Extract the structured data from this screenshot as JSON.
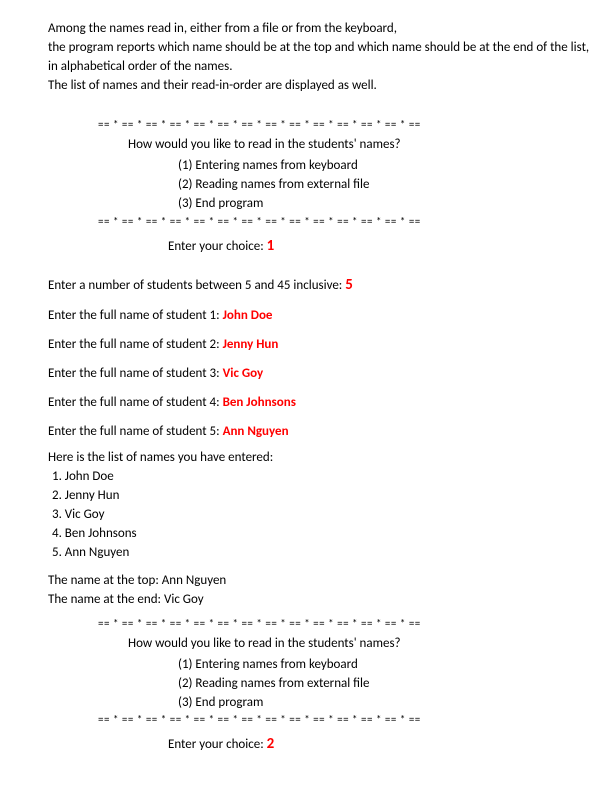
{
  "desc": {
    "l1": "Among the names read in, either from a file or from the keyboard,",
    "l2": "the program reports which name should be at the top and which name should be at the end of the list,",
    "l3": "in alphabetical order of the names.",
    "l4": "The list of names and their read-in-order are displayed as well."
  },
  "sep": "== * == * == * == * == * == * == * == * == * == * == * == * == * ==",
  "menu": {
    "question": "How would you like to read in the students' names?",
    "opt1": "(1) Entering names from keyboard",
    "opt2": "(2) Reading names from external file",
    "opt3": "(3) End program"
  },
  "choice_label": "Enter your choice: ",
  "choice1": "1",
  "count_prompt": "Enter a number of students between 5 and 45 inclusive: ",
  "count_value": "5",
  "name_prompt_prefix": "Enter the full name of student ",
  "students": [
    {
      "idx": "1",
      "name": "John Doe"
    },
    {
      "idx": "2",
      "name": "Jenny Hun"
    },
    {
      "idx": "3",
      "name": "Vic Goy"
    },
    {
      "idx": "4",
      "name": "Ben Johnsons"
    },
    {
      "idx": "5",
      "name": "Ann Nguyen"
    }
  ],
  "list_header": "Here is the list of names you have entered:",
  "list": [
    " 1. John Doe",
    " 2. Jenny Hun",
    " 3. Vic Goy",
    " 4. Ben Johnsons",
    " 5. Ann Nguyen"
  ],
  "top_label": "The name at the top: ",
  "top_name": "Ann Nguyen",
  "end_label": "The name at the end: ",
  "end_name": "Vic Goy",
  "choice2": "2"
}
